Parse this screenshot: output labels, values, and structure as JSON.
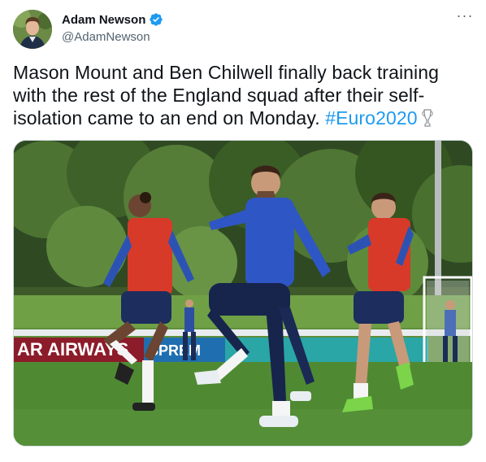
{
  "author": {
    "display_name": "Adam Newson",
    "handle": "@AdamNewson",
    "verified": true,
    "avatar_icon": "profile-photo"
  },
  "menu": {
    "more_label": "···"
  },
  "tweet": {
    "text_before": "Mason Mount and Ben Chilwell finally back training with the rest of the England squad after their self-isolation came to an end on Monday. ",
    "hashtag": "#Euro2020",
    "emoji_icon": "trophy-icon"
  },
  "media": {
    "board_text_left": "AR AIRWAYS",
    "board_text_right": "SPREM"
  },
  "colors": {
    "accent": "#1d9bf0",
    "text": "#0f1419",
    "secondary": "#536471"
  }
}
